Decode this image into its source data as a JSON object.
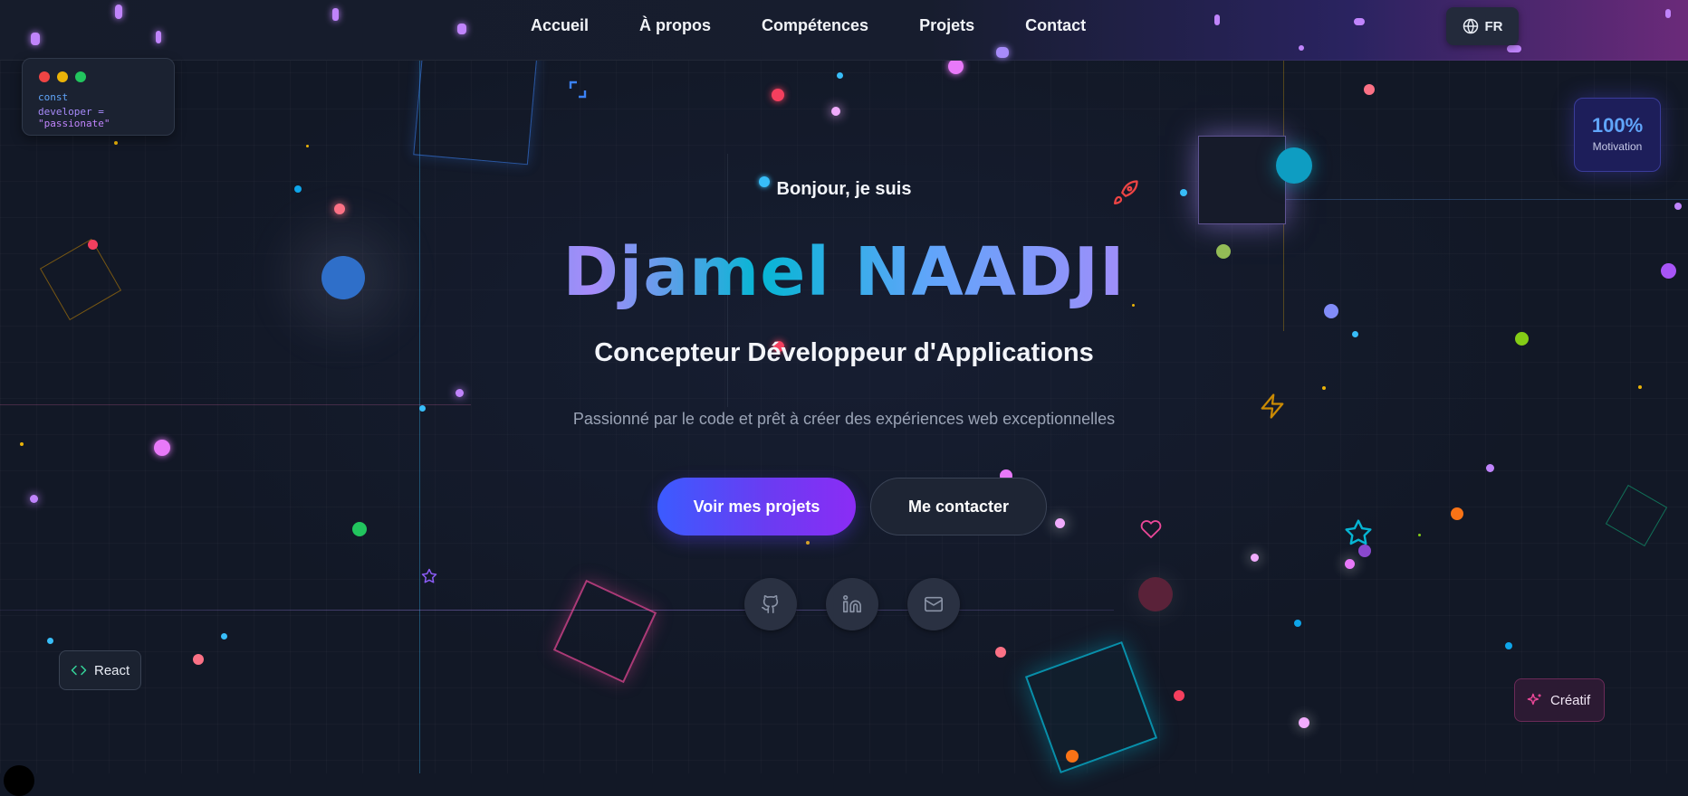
{
  "nav": {
    "items": [
      {
        "label": "Accueil"
      },
      {
        "label": "À propos"
      },
      {
        "label": "Compétences"
      },
      {
        "label": "Projets"
      },
      {
        "label": "Contact"
      }
    ],
    "language": "FR"
  },
  "code_card": {
    "line1": "const",
    "line2_keyword": "developer = ",
    "line2_value": "\"passionate\""
  },
  "hero": {
    "intro": "Bonjour, je suis",
    "name": "Djamel NAADJI",
    "title": "Concepteur Développeur d'Applications",
    "subtitle": "Passionné par le code et prêt à créer des expériences web exceptionnelles",
    "primary_button": "Voir mes projets",
    "secondary_button": "Me contacter"
  },
  "motivation": {
    "value": "100%",
    "label": "Motivation"
  },
  "badges": {
    "react": "React",
    "creatif": "Créatif"
  },
  "social": [
    {
      "icon": "github-icon"
    },
    {
      "icon": "linkedin-icon"
    },
    {
      "icon": "mail-icon"
    }
  ],
  "colors": {
    "background": "#121826",
    "accent_blue": "#3b5bff",
    "accent_purple": "#8b2cf5",
    "accent_cyan": "#06b6d4"
  }
}
